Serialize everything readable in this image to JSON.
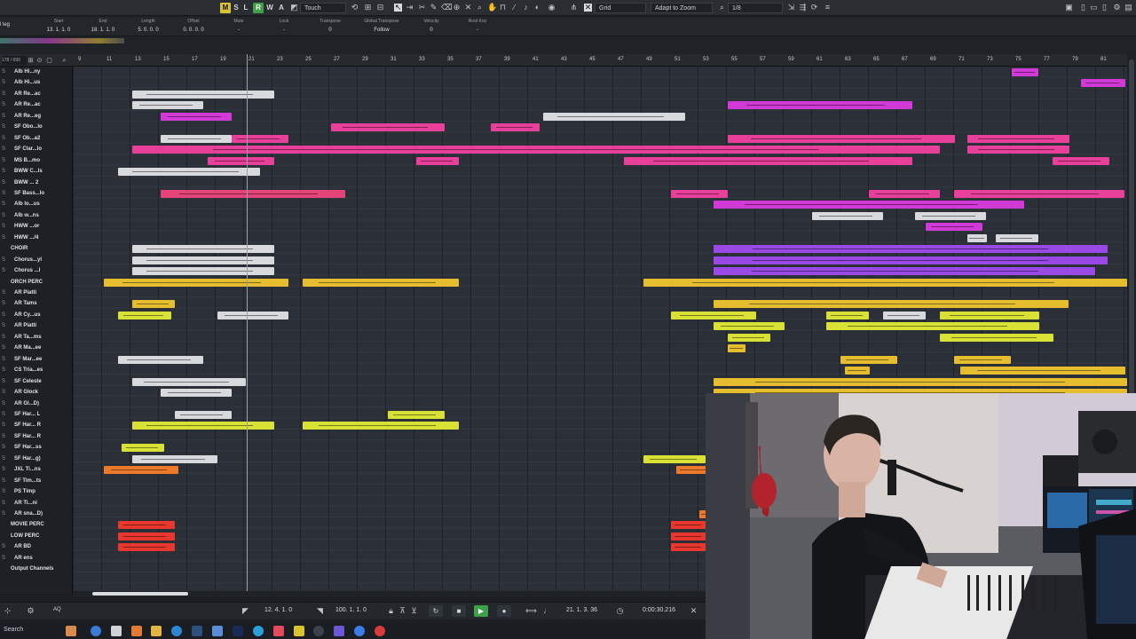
{
  "toolbar": {
    "m": "M",
    "s": "S",
    "l": "L",
    "r": "R",
    "w": "W",
    "a": "A",
    "automation_mode": "Touch",
    "snap_type": "Grid",
    "grid_size": "Adapt to Zoom",
    "quantize": "1/8"
  },
  "info_line": {
    "name": "l leg",
    "fields": [
      {
        "label": "Start",
        "value": "13. 1. 1. 0"
      },
      {
        "label": "End",
        "value": "18. 1. 1. 0"
      },
      {
        "label": "Length",
        "value": "5. 0. 0. 0"
      },
      {
        "label": "Offset",
        "value": "0. 0. 0. 0"
      },
      {
        "label": "Mute",
        "value": "-"
      },
      {
        "label": "Lock",
        "value": "-"
      },
      {
        "label": "Transpose",
        "value": "0"
      },
      {
        "label": "Global Transpose",
        "value": "Follow"
      },
      {
        "label": "Velocity",
        "value": "0"
      },
      {
        "label": "Root Key",
        "value": "-"
      }
    ]
  },
  "track_count": "178 / 690",
  "ruler": [
    "9",
    "11",
    "13",
    "15",
    "17",
    "19",
    "21",
    "23",
    "25",
    "27",
    "29",
    "31",
    "33",
    "35",
    "37",
    "39",
    "41",
    "43",
    "45",
    "47",
    "49",
    "51",
    "53",
    "55",
    "57",
    "59",
    "61",
    "63",
    "65",
    "67",
    "69",
    "71",
    "73",
    "75",
    "77",
    "79",
    "81"
  ],
  "tracks": [
    "Alb Hi...ny",
    "Alb Hi...us",
    "AR Re...ac",
    "AR Re...ac",
    "AR Re...eg",
    "SF Obo...lo",
    "SF Ob...a2",
    "SF Clar...lo",
    "MS B...mo",
    "BWW C...ls",
    "BWW ... 2",
    "SF Bass...lo",
    "Alb lo...us",
    "Alb w...ns",
    "HWW ...or",
    "HWW .../4",
    "CHOIR",
    "Chorus...yl",
    "Chorus ...l",
    "ORCH PERC",
    "AR Piatti",
    "AR Tams",
    "AR Cy...us",
    "AR Piatti",
    "AR Ta...ms",
    "AR Ma...ee",
    "SF Mar...ee",
    "CS Tria...es",
    "SF Celeste",
    "AR Glock",
    "AR Gl...D)",
    "SF Har... L",
    "SF Har... R",
    "SF Har... R",
    "SF Har...ss",
    "SF Har...g)",
    "JXL Ti...ns",
    "SF Tim...ts",
    "PS Timp",
    "AR Ti...ni",
    "AR sna...D)",
    "MOVIE PERC",
    "LOW PERC",
    "AR BD",
    "AR ens",
    "Output Channels"
  ],
  "transport": {
    "left_locator": "12. 4. 1. 0",
    "right_locator": "100. 1. 1. 0",
    "position_bars": "21. 1. 3. 36",
    "position_time": "0:00:30.216"
  },
  "taskbar": {
    "search": "Search"
  },
  "colors": {
    "white": "#d7d9dc",
    "pink": "#e8409a",
    "magenta": "#d13ad7",
    "purple": "#9a48e6",
    "yellow": "#e6bd2f",
    "lime": "#d9e234",
    "red": "#e8372e",
    "orange": "#ec7a2a"
  }
}
